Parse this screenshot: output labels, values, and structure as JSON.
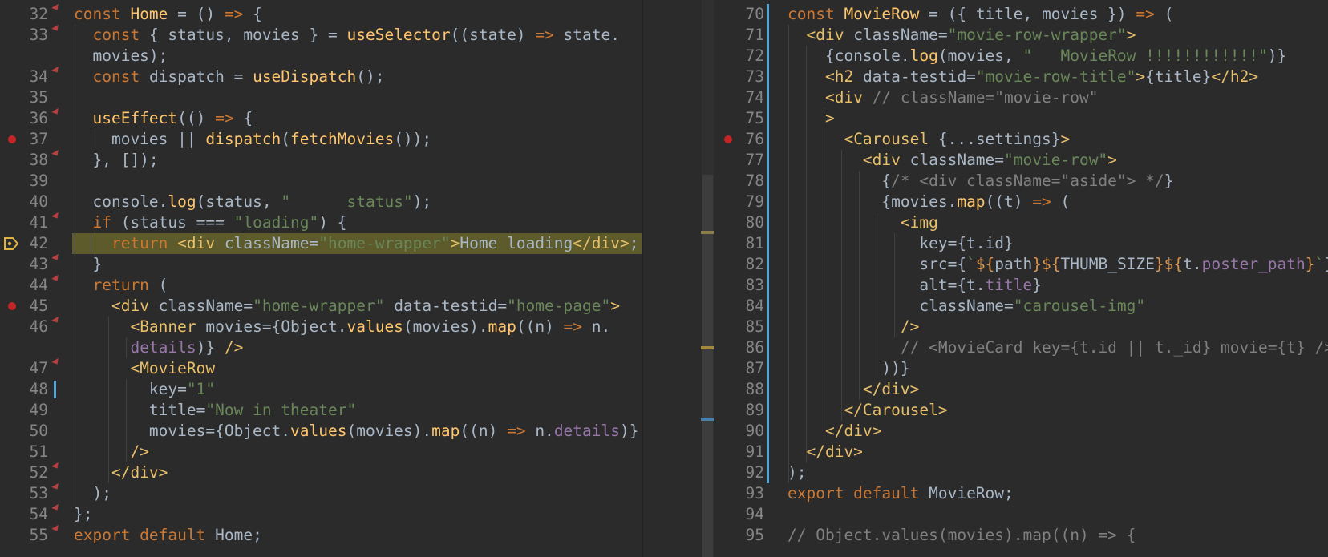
{
  "colors": {
    "background": "#2b2b2b",
    "keyword": "#cc7832",
    "function": "#ffc66d",
    "string": "#6a8759",
    "property": "#9876aa",
    "tag": "#e8bf6a",
    "comment": "#808080",
    "line_number": "#858585",
    "breakpoint": "#c22525",
    "highlight_line": "#5d5b2b",
    "change_marker": "#4ea7d8"
  },
  "left_editor": {
    "lines": [
      {
        "n": "32",
        "segs": [
          [
            "kw",
            "const "
          ],
          [
            "fn",
            "Home"
          ],
          [
            "pl",
            " = () "
          ],
          [
            "op",
            "=>"
          ],
          [
            "pl",
            " {"
          ]
        ]
      },
      {
        "n": "33",
        "segs": [
          [
            "pl",
            "  "
          ],
          [
            "kw",
            "const "
          ],
          [
            "pl",
            "{ status, movies } = "
          ],
          [
            "fn",
            "useSelector"
          ],
          [
            "pl",
            "((state) "
          ],
          [
            "op",
            "=>"
          ],
          [
            "pl",
            " state."
          ]
        ]
      },
      {
        "n": "",
        "segs": [
          [
            "pl",
            "  movies);"
          ]
        ]
      },
      {
        "n": "34",
        "segs": [
          [
            "pl",
            "  "
          ],
          [
            "kw",
            "const "
          ],
          [
            "pl",
            "dispatch = "
          ],
          [
            "fn",
            "useDispatch"
          ],
          [
            "pl",
            "();"
          ]
        ]
      },
      {
        "n": "35",
        "segs": []
      },
      {
        "n": "36",
        "segs": [
          [
            "pl",
            "  "
          ],
          [
            "fn",
            "useEffect"
          ],
          [
            "pl",
            "(() "
          ],
          [
            "op",
            "=>"
          ],
          [
            "pl",
            " {"
          ]
        ]
      },
      {
        "n": "37",
        "segs": [
          [
            "pl",
            "    movies || "
          ],
          [
            "fn",
            "dispatch"
          ],
          [
            "pl",
            "("
          ],
          [
            "fn",
            "fetchMovies"
          ],
          [
            "pl",
            "());"
          ]
        ]
      },
      {
        "n": "38",
        "segs": [
          [
            "pl",
            "  }, []);"
          ]
        ]
      },
      {
        "n": "39",
        "segs": []
      },
      {
        "n": "40",
        "segs": [
          [
            "pl",
            "  console."
          ],
          [
            "fn",
            "log"
          ],
          [
            "pl",
            "(status, "
          ],
          [
            "st",
            "\"      status\""
          ],
          [
            "pl",
            ");"
          ]
        ]
      },
      {
        "n": "41",
        "segs": [
          [
            "pl",
            "  "
          ],
          [
            "kw",
            "if "
          ],
          [
            "pl",
            "(status === "
          ],
          [
            "st",
            "\"loading\""
          ],
          [
            "pl",
            ") {"
          ]
        ]
      },
      {
        "n": "42",
        "segs": [
          [
            "pl",
            "  "
          ],
          [
            "kw",
            "  return "
          ],
          [
            "tg",
            "<div "
          ],
          [
            "pl",
            "className="
          ],
          [
            "st",
            "\"home-wrapper\""
          ],
          [
            "tg",
            ">"
          ],
          [
            "pl",
            "Home loading"
          ],
          [
            "tg",
            "</div>"
          ],
          [
            "pl",
            ";"
          ]
        ]
      },
      {
        "n": "43",
        "segs": [
          [
            "pl",
            "  }"
          ]
        ]
      },
      {
        "n": "44",
        "segs": [
          [
            "pl",
            "  "
          ],
          [
            "kw",
            "return "
          ],
          [
            "pl",
            "("
          ]
        ]
      },
      {
        "n": "45",
        "segs": [
          [
            "pl",
            "    "
          ],
          [
            "tg",
            "<div "
          ],
          [
            "pl",
            "className="
          ],
          [
            "st",
            "\"home-wrapper\""
          ],
          [
            "pl",
            " data-testid="
          ],
          [
            "st",
            "\"home-page\""
          ],
          [
            "tg",
            ">"
          ]
        ]
      },
      {
        "n": "46",
        "segs": [
          [
            "pl",
            "      "
          ],
          [
            "tg",
            "<Banner "
          ],
          [
            "pl",
            "movies={Object."
          ],
          [
            "fn",
            "values"
          ],
          [
            "pl",
            "(movies)."
          ],
          [
            "fn",
            "map"
          ],
          [
            "pl",
            "((n) "
          ],
          [
            "op",
            "=>"
          ],
          [
            "pl",
            " n."
          ]
        ]
      },
      {
        "n": "",
        "segs": [
          [
            "pl",
            "      "
          ],
          [
            "pr",
            "details"
          ],
          [
            "pl",
            ")} "
          ],
          [
            "tg",
            "/>"
          ]
        ]
      },
      {
        "n": "47",
        "segs": [
          [
            "pl",
            "      "
          ],
          [
            "tg",
            "<MovieRow"
          ]
        ]
      },
      {
        "n": "48",
        "segs": [
          [
            "pl",
            "        key="
          ],
          [
            "st",
            "\"1\""
          ]
        ]
      },
      {
        "n": "49",
        "segs": [
          [
            "pl",
            "        title="
          ],
          [
            "st",
            "\"Now in theater\""
          ]
        ]
      },
      {
        "n": "50",
        "segs": [
          [
            "pl",
            "        movies={Object."
          ],
          [
            "fn",
            "values"
          ],
          [
            "pl",
            "(movies)."
          ],
          [
            "fn",
            "map"
          ],
          [
            "pl",
            "((n) "
          ],
          [
            "op",
            "=>"
          ],
          [
            "pl",
            " n."
          ],
          [
            "pr",
            "details"
          ],
          [
            "pl",
            ")}"
          ]
        ]
      },
      {
        "n": "51",
        "segs": [
          [
            "pl",
            "      "
          ],
          [
            "tg",
            "/>"
          ]
        ]
      },
      {
        "n": "52",
        "segs": [
          [
            "pl",
            "    "
          ],
          [
            "tg",
            "</div>"
          ]
        ]
      },
      {
        "n": "53",
        "segs": [
          [
            "pl",
            "  );"
          ]
        ]
      },
      {
        "n": "54",
        "segs": [
          [
            "pl",
            "};"
          ]
        ]
      },
      {
        "n": "55",
        "segs": [
          [
            "kw",
            "export default "
          ],
          [
            "pl",
            "Home;"
          ]
        ]
      }
    ]
  },
  "right_editor": {
    "lines": [
      {
        "n": "70",
        "segs": [
          [
            "kw",
            "const "
          ],
          [
            "fn",
            "MovieRow"
          ],
          [
            "pl",
            " = ({ title, movies }) "
          ],
          [
            "op",
            "=>"
          ],
          [
            "pl",
            " ("
          ]
        ]
      },
      {
        "n": "71",
        "segs": [
          [
            "pl",
            "  "
          ],
          [
            "tg",
            "<div "
          ],
          [
            "pl",
            "className="
          ],
          [
            "st",
            "\"movie-row-wrapper\""
          ],
          [
            "tg",
            ">"
          ]
        ]
      },
      {
        "n": "72",
        "segs": [
          [
            "pl",
            "    {console."
          ],
          [
            "fn",
            "log"
          ],
          [
            "pl",
            "(movies, "
          ],
          [
            "st",
            "\"   MovieRow !!!!!!!!!!!!\""
          ],
          [
            "pl",
            ")}"
          ]
        ]
      },
      {
        "n": "73",
        "segs": [
          [
            "pl",
            "    "
          ],
          [
            "tg",
            "<h2 "
          ],
          [
            "pl",
            "data-testid="
          ],
          [
            "st",
            "\"movie-row-title\""
          ],
          [
            "tg",
            ">"
          ],
          [
            "pl",
            "{title}"
          ],
          [
            "tg",
            "</h2>"
          ]
        ]
      },
      {
        "n": "74",
        "segs": [
          [
            "pl",
            "    "
          ],
          [
            "tg",
            "<div "
          ],
          [
            "cm",
            "// className=\"movie-row\""
          ]
        ]
      },
      {
        "n": "75",
        "segs": [
          [
            "pl",
            "    "
          ],
          [
            "tg",
            ">"
          ]
        ]
      },
      {
        "n": "76",
        "segs": [
          [
            "pl",
            "      "
          ],
          [
            "tg",
            "<Carousel "
          ],
          [
            "pl",
            "{...settings}"
          ],
          [
            "tg",
            ">"
          ]
        ]
      },
      {
        "n": "77",
        "segs": [
          [
            "pl",
            "        "
          ],
          [
            "tg",
            "<div "
          ],
          [
            "pl",
            "className="
          ],
          [
            "st",
            "\"movie-row\""
          ],
          [
            "tg",
            ">"
          ]
        ]
      },
      {
        "n": "78",
        "segs": [
          [
            "pl",
            "          {"
          ],
          [
            "cm",
            "/* <div className=\"aside\"> */"
          ],
          [
            "pl",
            "}"
          ]
        ]
      },
      {
        "n": "79",
        "segs": [
          [
            "pl",
            "          {movies."
          ],
          [
            "fn",
            "map"
          ],
          [
            "pl",
            "((t) "
          ],
          [
            "op",
            "=>"
          ],
          [
            "pl",
            " ("
          ]
        ]
      },
      {
        "n": "80",
        "segs": [
          [
            "pl",
            "            "
          ],
          [
            "tg",
            "<img"
          ]
        ]
      },
      {
        "n": "81",
        "segs": [
          [
            "pl",
            "              key={t.id}"
          ]
        ]
      },
      {
        "n": "82",
        "segs": [
          [
            "pl",
            "              src={"
          ],
          [
            "st",
            "`"
          ],
          [
            "or",
            "${"
          ],
          [
            "pl",
            "path"
          ],
          [
            "or",
            "}${"
          ],
          [
            "pl",
            "THUMB_SIZE"
          ],
          [
            "or",
            "}${"
          ],
          [
            "pl",
            "t."
          ],
          [
            "pr",
            "poster_path"
          ],
          [
            "or",
            "}"
          ],
          [
            "st",
            "`"
          ],
          [
            "pl",
            "}"
          ]
        ]
      },
      {
        "n": "83",
        "segs": [
          [
            "pl",
            "              alt={t."
          ],
          [
            "pr",
            "title"
          ],
          [
            "pl",
            "}"
          ]
        ]
      },
      {
        "n": "84",
        "segs": [
          [
            "pl",
            "              className="
          ],
          [
            "st",
            "\"carousel-img\""
          ]
        ]
      },
      {
        "n": "85",
        "segs": [
          [
            "pl",
            "            "
          ],
          [
            "tg",
            "/>"
          ]
        ]
      },
      {
        "n": "86",
        "segs": [
          [
            "pl",
            "            "
          ],
          [
            "cm",
            "// <MovieCard key={t.id || t._id} movie={t} />"
          ]
        ]
      },
      {
        "n": "87",
        "segs": [
          [
            "pl",
            "          ))}"
          ]
        ]
      },
      {
        "n": "88",
        "segs": [
          [
            "pl",
            "        "
          ],
          [
            "tg",
            "</div>"
          ]
        ]
      },
      {
        "n": "89",
        "segs": [
          [
            "pl",
            "      "
          ],
          [
            "tg",
            "</Carousel>"
          ]
        ]
      },
      {
        "n": "90",
        "segs": [
          [
            "pl",
            "    "
          ],
          [
            "tg",
            "</div>"
          ]
        ]
      },
      {
        "n": "91",
        "segs": [
          [
            "pl",
            "  "
          ],
          [
            "tg",
            "</div>"
          ]
        ]
      },
      {
        "n": "92",
        "segs": [
          [
            "pl",
            ");"
          ]
        ]
      },
      {
        "n": "93",
        "segs": [
          [
            "kw",
            "export default "
          ],
          [
            "pl",
            "MovieRow;"
          ]
        ]
      },
      {
        "n": "94",
        "segs": []
      },
      {
        "n": "95",
        "segs": [
          [
            "cm",
            "// Object.values(movies).map((n) => {"
          ]
        ]
      }
    ]
  }
}
